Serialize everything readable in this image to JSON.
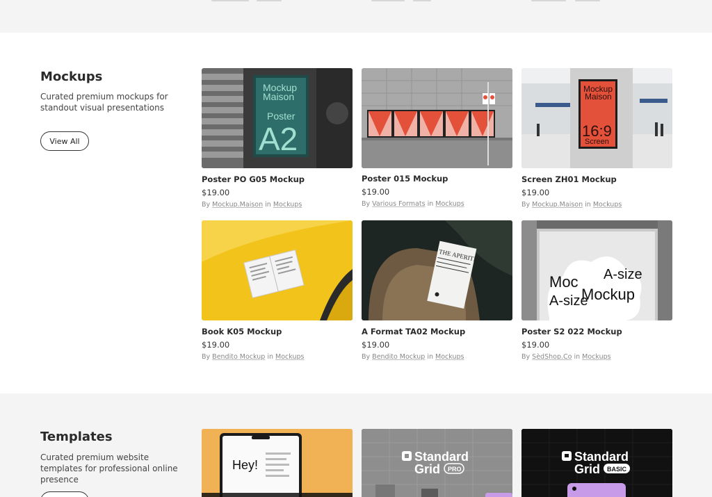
{
  "mockups": {
    "title": "Mockups",
    "description": "Curated premium mockups for standout visual presentations",
    "view_all": "View All",
    "items": [
      {
        "title": "Poster PO G05 Mockup",
        "price": "$19.00",
        "by": "By",
        "author": "Mockup.Maison",
        "in": "in",
        "category": "Mockups",
        "thumb_text": {
          "line1": "Mockup",
          "line2": "Maison",
          "line3": "Poster",
          "line4": "A2"
        }
      },
      {
        "title": "Poster 015 Mockup",
        "price": "$19.00",
        "by": "By",
        "author": "Various Formats",
        "in": "in",
        "category": "Mockups"
      },
      {
        "title": "Screen ZH01 Mockup",
        "price": "$19.00",
        "by": "By",
        "author": "Mockup.Maison",
        "in": "in",
        "category": "Mockups",
        "thumb_text": {
          "line1": "Mockup",
          "line2": "Maison",
          "line3": "16:9",
          "line4": "Screen"
        }
      },
      {
        "title": "Book K05 Mockup",
        "price": "$19.00",
        "by": "By",
        "author": "Bendito Mockup",
        "in": "in",
        "category": "Mockups"
      },
      {
        "title": "A Format TA02 Mockup",
        "price": "$19.00",
        "by": "By",
        "author": "Bendito Mockup",
        "in": "in",
        "category": "Mockups",
        "thumb_text": {
          "line1": "THE APERITIVO"
        }
      },
      {
        "title": "Poster S2 022 Mockup",
        "price": "$19.00",
        "by": "By",
        "author": "SèdShop.Co",
        "in": "in",
        "category": "Mockups",
        "thumb_text": {
          "line1": "A-size",
          "line2": "Mockup",
          "line3": "A-size",
          "line4": "Moc"
        }
      }
    ]
  },
  "templates": {
    "title": "Templates",
    "description": "Curated premium website templates for professional online presence",
    "items": [
      {
        "thumb_text": "Hey!"
      },
      {
        "brand1": "Standard",
        "brand2": "Grid",
        "badge": "PRO"
      },
      {
        "brand1": "Standard",
        "brand2": "Grid",
        "badge": "BASIC"
      }
    ]
  },
  "colors": {
    "accent_red": "#e4513b",
    "poster_teal": "#2e6e6a",
    "yellow": "#f2c31b"
  }
}
